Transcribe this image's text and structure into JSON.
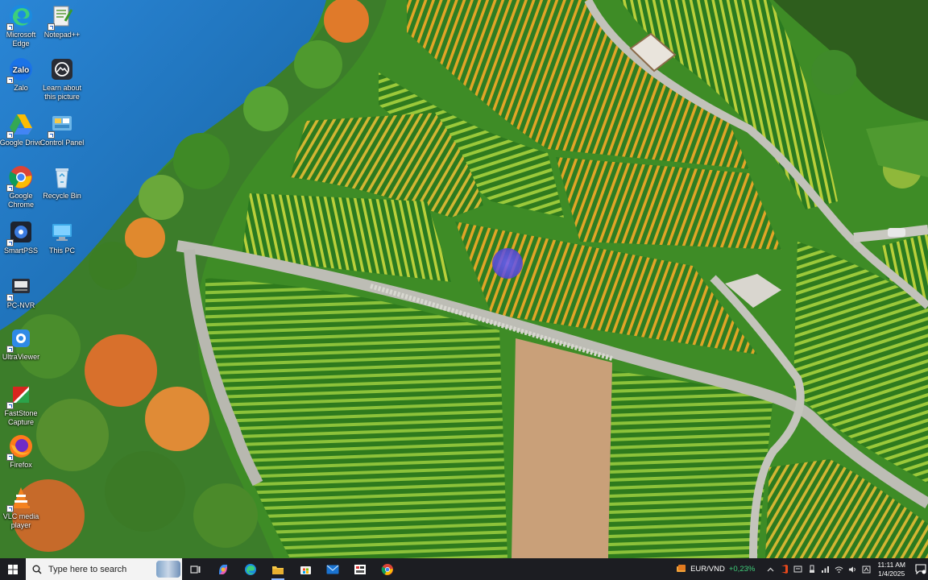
{
  "desktop": {
    "icons": [
      {
        "label": "Microsoft Edge",
        "icon": "edge-icon"
      },
      {
        "label": "Notepad++",
        "icon": "notepad-plus-plus-icon"
      },
      {
        "label": "Zalo",
        "icon": "zalo-icon"
      },
      {
        "label": "Learn about this picture",
        "icon": "camera-icon"
      },
      {
        "label": "Google Drive",
        "icon": "google-drive-icon"
      },
      {
        "label": "Control Panel",
        "icon": "control-panel-icon"
      },
      {
        "label": "Google Chrome",
        "icon": "chrome-icon"
      },
      {
        "label": "Recycle Bin",
        "icon": "recycle-bin-icon"
      },
      {
        "label": "SmartPSS",
        "icon": "smartpss-icon"
      },
      {
        "label": "This PC",
        "icon": "this-pc-icon"
      },
      {
        "label": "PC-NVR",
        "icon": "pc-nvr-icon"
      },
      {
        "label": "UltraViewer",
        "icon": "ultraviewer-icon"
      },
      {
        "label": "FastStone Capture",
        "icon": "faststone-capture-icon"
      },
      {
        "label": "Firefox",
        "icon": "firefox-icon"
      },
      {
        "label": "VLC media player",
        "icon": "vlc-icon"
      }
    ]
  },
  "taskbar": {
    "search_placeholder": "Type here to search",
    "apps": [
      {
        "icon": "task-view-icon"
      },
      {
        "icon": "copilot-icon"
      },
      {
        "icon": "edge-icon"
      },
      {
        "icon": "file-explorer-icon"
      },
      {
        "icon": "microsoft-store-icon"
      },
      {
        "icon": "mail-icon"
      },
      {
        "icon": "snipping-icon"
      },
      {
        "icon": "chrome-icon"
      }
    ],
    "ticker": {
      "pair": "EUR/VND",
      "change": "+0,23%",
      "change_color": "#3fd07a"
    },
    "clock": {
      "time": "11:11 AM",
      "date": "1/4/2025"
    }
  },
  "colors": {
    "taskbar_bg": "#1c1d22",
    "water": "#1f78c8",
    "vines": "#3f8a25"
  }
}
